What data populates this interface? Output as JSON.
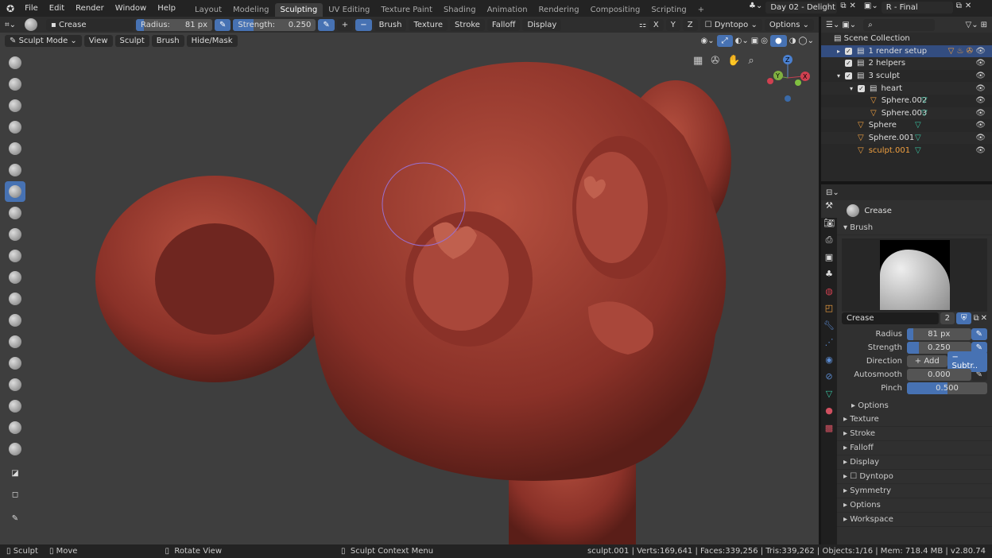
{
  "topbar": {
    "menus": [
      "File",
      "Edit",
      "Render",
      "Window",
      "Help"
    ],
    "workspaces": [
      "Layout",
      "Modeling",
      "Sculpting",
      "UV Editing",
      "Texture Paint",
      "Shading",
      "Animation",
      "Rendering",
      "Compositing",
      "Scripting"
    ],
    "active_workspace": "Sculpting",
    "add_tab": "+",
    "scene": "Day 02 - Delight",
    "view_layer": "R - Final"
  },
  "tool_header": {
    "brush_name": "Crease",
    "radius_label": "Radius:",
    "radius": "81 px",
    "strength_label": "Strength:",
    "strength": "0.250",
    "radius_fraction": 0.1,
    "strength_fraction": 0.25,
    "plus": "+",
    "minus": "−",
    "menus": [
      "Brush",
      "Texture",
      "Stroke",
      "Falloff",
      "Display"
    ],
    "axes": [
      "X",
      "Y",
      "Z"
    ],
    "dyntopo": "Dyntopo",
    "options": "Options"
  },
  "viewport_header": {
    "mode": "Sculpt Mode",
    "menus": [
      "View",
      "Sculpt",
      "Brush",
      "Hide/Mask"
    ]
  },
  "gizmo": {
    "x": "X",
    "y": "Y",
    "z": "Z"
  },
  "outliner": {
    "root": "Scene Collection",
    "items": [
      {
        "name": "1 render setup",
        "depth": 0,
        "type": "collection",
        "selected": true
      },
      {
        "name": "2 helpers",
        "depth": 0,
        "type": "collection"
      },
      {
        "name": "3 sculpt",
        "depth": 0,
        "type": "collection"
      },
      {
        "name": "heart",
        "depth": 1,
        "type": "collection"
      },
      {
        "name": "Sphere.002",
        "depth": 2,
        "type": "mesh"
      },
      {
        "name": "Sphere.003",
        "depth": 2,
        "type": "mesh"
      },
      {
        "name": "Sphere",
        "depth": 1,
        "type": "mesh"
      },
      {
        "name": "Sphere.001",
        "depth": 1,
        "type": "mesh"
      },
      {
        "name": "sculpt.001",
        "depth": 1,
        "type": "mesh",
        "active": true
      }
    ]
  },
  "properties": {
    "tool_name": "Crease",
    "brush_section": "Brush",
    "brush_field": "Crease",
    "users": "2",
    "rows": [
      {
        "label": "Radius",
        "value": "81 px",
        "fill": 0.1
      },
      {
        "label": "Strength",
        "value": "0.250",
        "fill": 0.25
      },
      {
        "label": "Autosmooth",
        "value": "0.000",
        "fill": 0
      },
      {
        "label": "Pinch",
        "value": "0.500",
        "fill": 0.5
      }
    ],
    "direction_label": "Direction",
    "add": "+ Add",
    "subtract": "− Subtr..",
    "options_sub": "Options",
    "sections": [
      "Texture",
      "Stroke",
      "Falloff",
      "Display",
      "Dyntopo",
      "Symmetry",
      "Options",
      "Workspace"
    ]
  },
  "status": {
    "sculpt": "Sculpt",
    "move": "Move",
    "rotate": "Rotate View",
    "context": "Sculpt Context Menu",
    "stats": "sculpt.001 | Verts:169,641 | Faces:339,256 | Tris:339,262 | Objects:1/16 | Mem: 718.4 MB | v2.80.74"
  },
  "colors": {
    "accent": "#4772b3",
    "skin": "#9a3a30",
    "object": "#f0a040",
    "mesh": "#3ac0a0"
  }
}
